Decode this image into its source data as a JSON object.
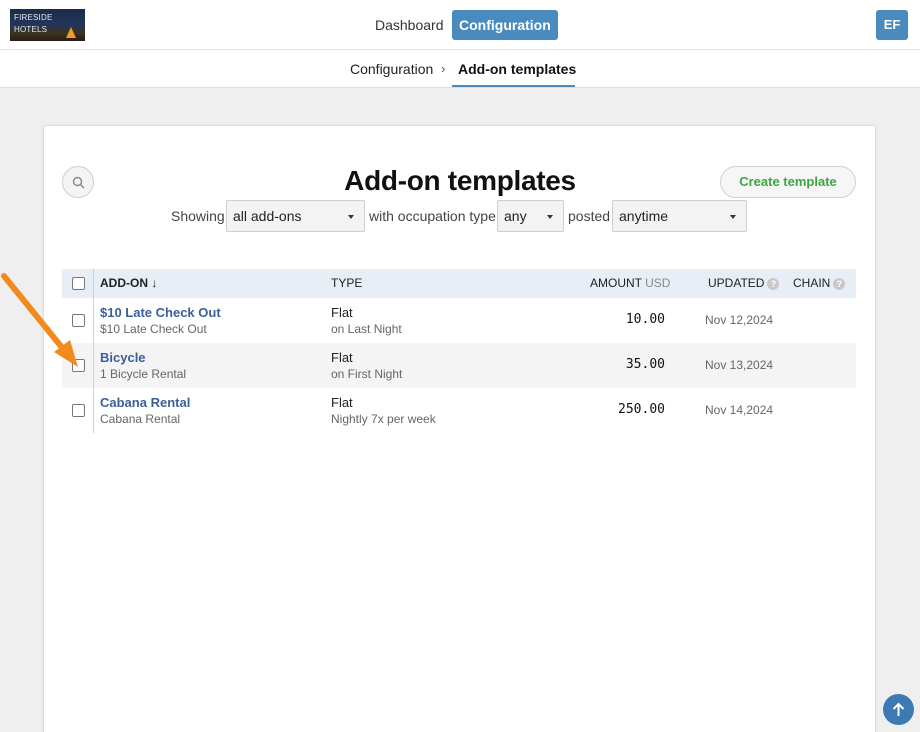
{
  "app": {
    "logo_text_line1": "FIRESIDE",
    "logo_text_line2": "HOTELS",
    "nav": {
      "dashboard": "Dashboard",
      "configuration": "Configuration"
    },
    "user_initials": "EF"
  },
  "breadcrumb": {
    "parent": "Configuration",
    "separator": "›",
    "current": "Add-on templates"
  },
  "page": {
    "title": "Add-on templates",
    "create_button": "Create template"
  },
  "filters": {
    "showing_label": "Showing",
    "showing_value": "all add-ons",
    "occupation_label": "with occupation type",
    "occupation_value": "any",
    "posted_label": "posted",
    "posted_value": "anytime"
  },
  "table": {
    "headers": {
      "addon": "ADD-ON ↓",
      "type": "TYPE",
      "amount": "AMOUNT",
      "amount_unit": "USD",
      "updated": "UPDATED",
      "chain": "CHAIN",
      "help": "?"
    },
    "rows": [
      {
        "name": "$10 Late Check Out",
        "description": "$10 Late Check Out",
        "type": "Flat",
        "type_detail": "on Last Night",
        "amount": "10.00",
        "updated": "Nov 12,2024"
      },
      {
        "name": "Bicycle",
        "description": "1 Bicycle Rental",
        "type": "Flat",
        "type_detail": "on First Night",
        "amount": "35.00",
        "updated": "Nov 13,2024"
      },
      {
        "name": "Cabana Rental",
        "description": "Cabana Rental",
        "type": "Flat",
        "type_detail": "Nightly 7x per week",
        "amount": "250.00",
        "updated": "Nov 14,2024"
      }
    ]
  },
  "colors": {
    "accent": "#4a8bbf",
    "link": "#3a5f9c",
    "create": "#3fa544",
    "annotation_arrow": "#f28a1e"
  },
  "icons": [
    "search-icon",
    "sort-down-icon",
    "help-icon",
    "caret-down-icon",
    "arrow-up-icon",
    "annotation-arrow-icon"
  ]
}
